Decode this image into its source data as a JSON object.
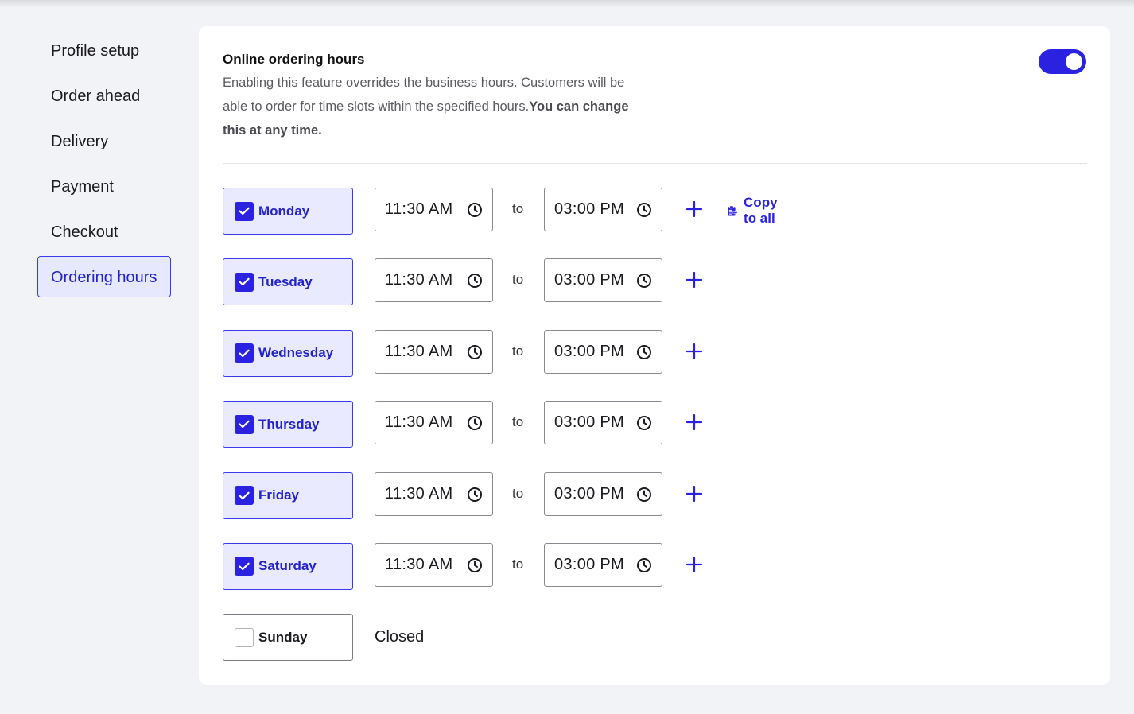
{
  "sidebar": {
    "items": [
      {
        "label": "Profile setup",
        "active": false
      },
      {
        "label": "Order ahead",
        "active": false
      },
      {
        "label": "Delivery",
        "active": false
      },
      {
        "label": "Payment",
        "active": false
      },
      {
        "label": "Checkout",
        "active": false
      },
      {
        "label": "Ordering hours",
        "active": true
      }
    ]
  },
  "feature": {
    "title": "Online ordering hours",
    "description": "Enabling this feature overrides the business hours. Customers will be able to order for time slots within the specified hours.",
    "description_bold": "You can change this at any time.",
    "toggle_on": true
  },
  "schedule": {
    "to_label": "to",
    "copy_all_label": "Copy to all",
    "closed_label": "Closed",
    "days": [
      {
        "name": "Monday",
        "checked": true,
        "start": "11:30 AM",
        "end": "03:00 PM"
      },
      {
        "name": "Tuesday",
        "checked": true,
        "start": "11:30 AM",
        "end": "03:00 PM"
      },
      {
        "name": "Wednesday",
        "checked": true,
        "start": "11:30 AM",
        "end": "03:00 PM"
      },
      {
        "name": "Thursday",
        "checked": true,
        "start": "11:30 AM",
        "end": "03:00 PM"
      },
      {
        "name": "Friday",
        "checked": true,
        "start": "11:30 AM",
        "end": "03:00 PM"
      },
      {
        "name": "Saturday",
        "checked": true,
        "start": "11:30 AM",
        "end": "03:00 PM"
      },
      {
        "name": "Sunday",
        "checked": false
      }
    ]
  },
  "colors": {
    "accent": "#2a22e0",
    "accent_text": "#2323c9",
    "active_bg": "#e9eafd",
    "page_bg": "#f2f3f7"
  }
}
